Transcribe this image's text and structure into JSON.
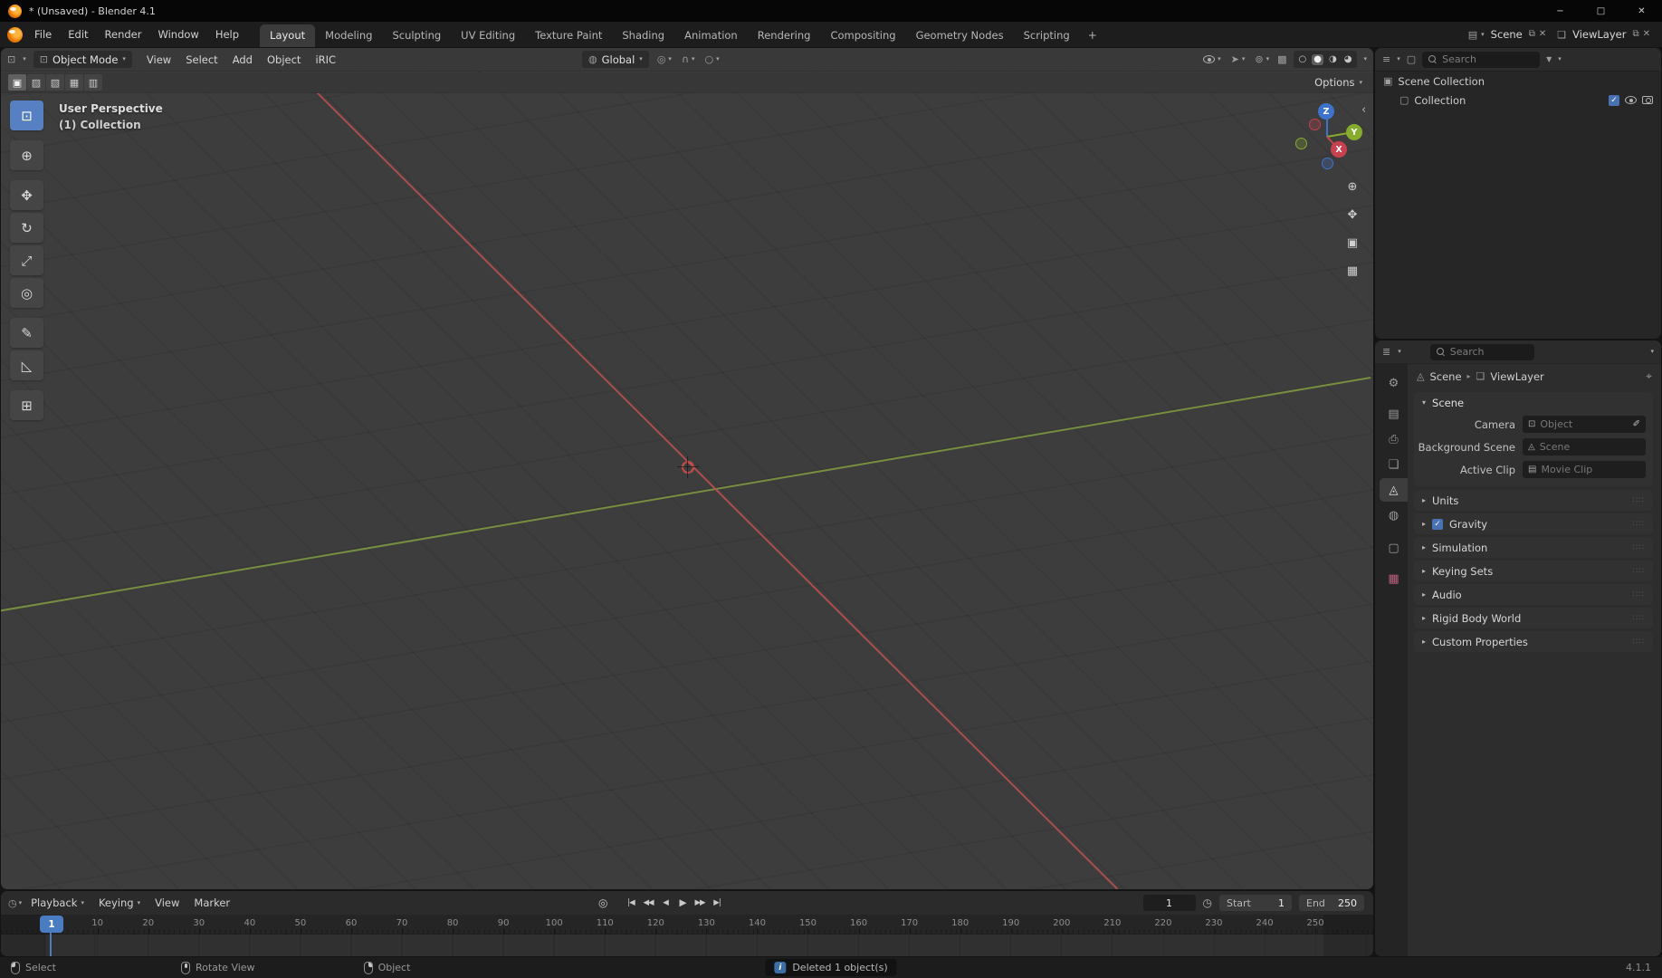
{
  "window": {
    "title": "* (Unsaved) - Blender 4.1",
    "min": "−",
    "max": "□",
    "close": "✕"
  },
  "icons": {
    "chevron_down": "▾",
    "caret_right": "▸",
    "check": "✓",
    "grip": "∷∷",
    "collapse_left": "‹"
  },
  "topbar": {
    "menus": [
      "File",
      "Edit",
      "Render",
      "Window",
      "Help"
    ],
    "tabs": [
      {
        "label": "Layout",
        "active": true
      },
      {
        "label": "Modeling"
      },
      {
        "label": "Sculpting"
      },
      {
        "label": "UV Editing"
      },
      {
        "label": "Texture Paint"
      },
      {
        "label": "Shading"
      },
      {
        "label": "Animation"
      },
      {
        "label": "Rendering"
      },
      {
        "label": "Compositing"
      },
      {
        "label": "Geometry Nodes"
      },
      {
        "label": "Scripting"
      }
    ],
    "add_tab": "+",
    "scene_selector": {
      "icon": "▤",
      "label": "Scene",
      "dup": "⧉",
      "close": "✕"
    },
    "viewlayer_selector": {
      "icon": "❏",
      "label": "ViewLayer",
      "dup": "⧉",
      "close": "✕"
    }
  },
  "viewport": {
    "header": {
      "editor_icon": "⊡",
      "mode": {
        "icon": "⊡",
        "label": "Object Mode"
      },
      "menus": [
        "View",
        "Select",
        "Add",
        "Object",
        "iRIC"
      ],
      "orientation": {
        "icon": "◍",
        "label": "Global"
      },
      "pivot_icon": "◎",
      "snap_icon": "∩",
      "prop_edit_icon": "○",
      "gizmo_icon": "➤",
      "overlays_icon": "⊚",
      "xray_icon": "▩",
      "shading": [
        "○",
        "●",
        "◑",
        "◕"
      ],
      "options": "Options"
    },
    "tool_settings_modes": [
      "▣",
      "▨",
      "▧",
      "▦",
      "▥"
    ],
    "overlay": {
      "line1": "User Perspective",
      "line2": "(1) Collection"
    },
    "gizmo": {
      "z": "Z",
      "y": "Y",
      "x": "X"
    },
    "side_tools": [
      {
        "name": "zoom",
        "glyph": "⊕"
      },
      {
        "name": "pan",
        "glyph": "✥"
      },
      {
        "name": "camera-view",
        "glyph": "▣"
      },
      {
        "name": "toggle-ortho",
        "glyph": "▦"
      }
    ]
  },
  "toolbar": {
    "tools": [
      {
        "name": "select-box",
        "glyph": "⊡",
        "active": true,
        "group": 1
      },
      {
        "name": "cursor",
        "glyph": "⊕",
        "group": 2
      },
      {
        "name": "move",
        "glyph": "✥",
        "group": 3
      },
      {
        "name": "rotate",
        "glyph": "↻",
        "group": 3
      },
      {
        "name": "scale",
        "glyph": "⤢",
        "group": 3
      },
      {
        "name": "transform",
        "glyph": "◎",
        "group": 3
      },
      {
        "name": "annotate",
        "glyph": "✎",
        "group": 4
      },
      {
        "name": "measure",
        "glyph": "◺",
        "group": 4
      },
      {
        "name": "add-cube",
        "glyph": "⊞",
        "group": 5
      }
    ]
  },
  "outliner": {
    "editor_icon": "≡",
    "filter_obj_icon": "▢",
    "search_placeholder": "Search",
    "filter_icon": "▼",
    "scene_collection": "Scene Collection",
    "sc_icon": "▣",
    "collection": "Collection",
    "col_icon": "▢"
  },
  "properties": {
    "editor_icon": "≣",
    "search_placeholder": "Search",
    "breadcrumb": {
      "scene_icon": "◬",
      "scene": "Scene",
      "separator": "▸",
      "viewlayer_icon": "❏",
      "viewlayer": "ViewLayer",
      "pin_icon": "⌖"
    },
    "tabs": [
      {
        "name": "tool",
        "glyph": "⚙"
      },
      {
        "name": "render",
        "glyph": "▤"
      },
      {
        "name": "output",
        "glyph": "⎙"
      },
      {
        "name": "view-layer",
        "glyph": "❏"
      },
      {
        "name": "scene",
        "glyph": "◬",
        "active": true
      },
      {
        "name": "world",
        "glyph": "◍"
      },
      {
        "name": "collection",
        "glyph": "▢"
      },
      {
        "name": "texture",
        "glyph": "▦",
        "tex": true
      }
    ],
    "eyedropper_icon": "✐",
    "scene_panel": {
      "title": "Scene",
      "rows": [
        {
          "label": "Camera",
          "icon": "⊡",
          "value": "Object",
          "eyedropper": true
        },
        {
          "label": "Background Scene",
          "icon": "◬",
          "value": "Scene"
        },
        {
          "label": "Active Clip",
          "icon": "▤",
          "value": "Movie Clip"
        }
      ]
    },
    "collapsed_panels": [
      {
        "label": "Units"
      },
      {
        "label": "Gravity",
        "checkbox": true
      },
      {
        "label": "Simulation"
      },
      {
        "label": "Keying Sets"
      },
      {
        "label": "Audio"
      },
      {
        "label": "Rigid Body World"
      },
      {
        "label": "Custom Properties"
      }
    ]
  },
  "timeline": {
    "editor_icon": "◷",
    "menus": [
      {
        "label": "Playback",
        "dd": true
      },
      {
        "label": "Keying",
        "dd": true
      },
      {
        "label": "View"
      },
      {
        "label": "Marker"
      }
    ],
    "autokey_icon": "◎",
    "transport": [
      {
        "name": "jump-to-start",
        "glyph": "|◀"
      },
      {
        "name": "prev-keyframe",
        "glyph": "◀◀"
      },
      {
        "name": "play-reverse",
        "glyph": "◀"
      },
      {
        "name": "play",
        "glyph": "▶"
      },
      {
        "name": "next-keyframe",
        "glyph": "▶▶"
      },
      {
        "name": "jump-to-end",
        "glyph": "▶|"
      }
    ],
    "current_frame": "1",
    "start": {
      "label": "Start",
      "value": "1"
    },
    "end": {
      "label": "End",
      "value": "250"
    },
    "ruler_marks": [
      1,
      10,
      20,
      30,
      40,
      50,
      60,
      70,
      80,
      90,
      100,
      110,
      120,
      130,
      140,
      150,
      160,
      170,
      180,
      190,
      200,
      210,
      220,
      230,
      240,
      250
    ]
  },
  "statusbar": {
    "hints": [
      {
        "mouse": "left",
        "label": "Select"
      },
      {
        "mouse": "middle",
        "label": "Rotate View"
      },
      {
        "mouse": "right",
        "label": "Object"
      }
    ],
    "message": "Deleted 1 object(s)",
    "version": "4.1.1"
  },
  "colors": {
    "accent": "#4772b3",
    "axis_x": "#b65050",
    "axis_y": "#809c40",
    "gizmo_x": "#c8414f",
    "gizmo_y": "#86ac2e",
    "gizmo_z": "#3e73cc"
  }
}
